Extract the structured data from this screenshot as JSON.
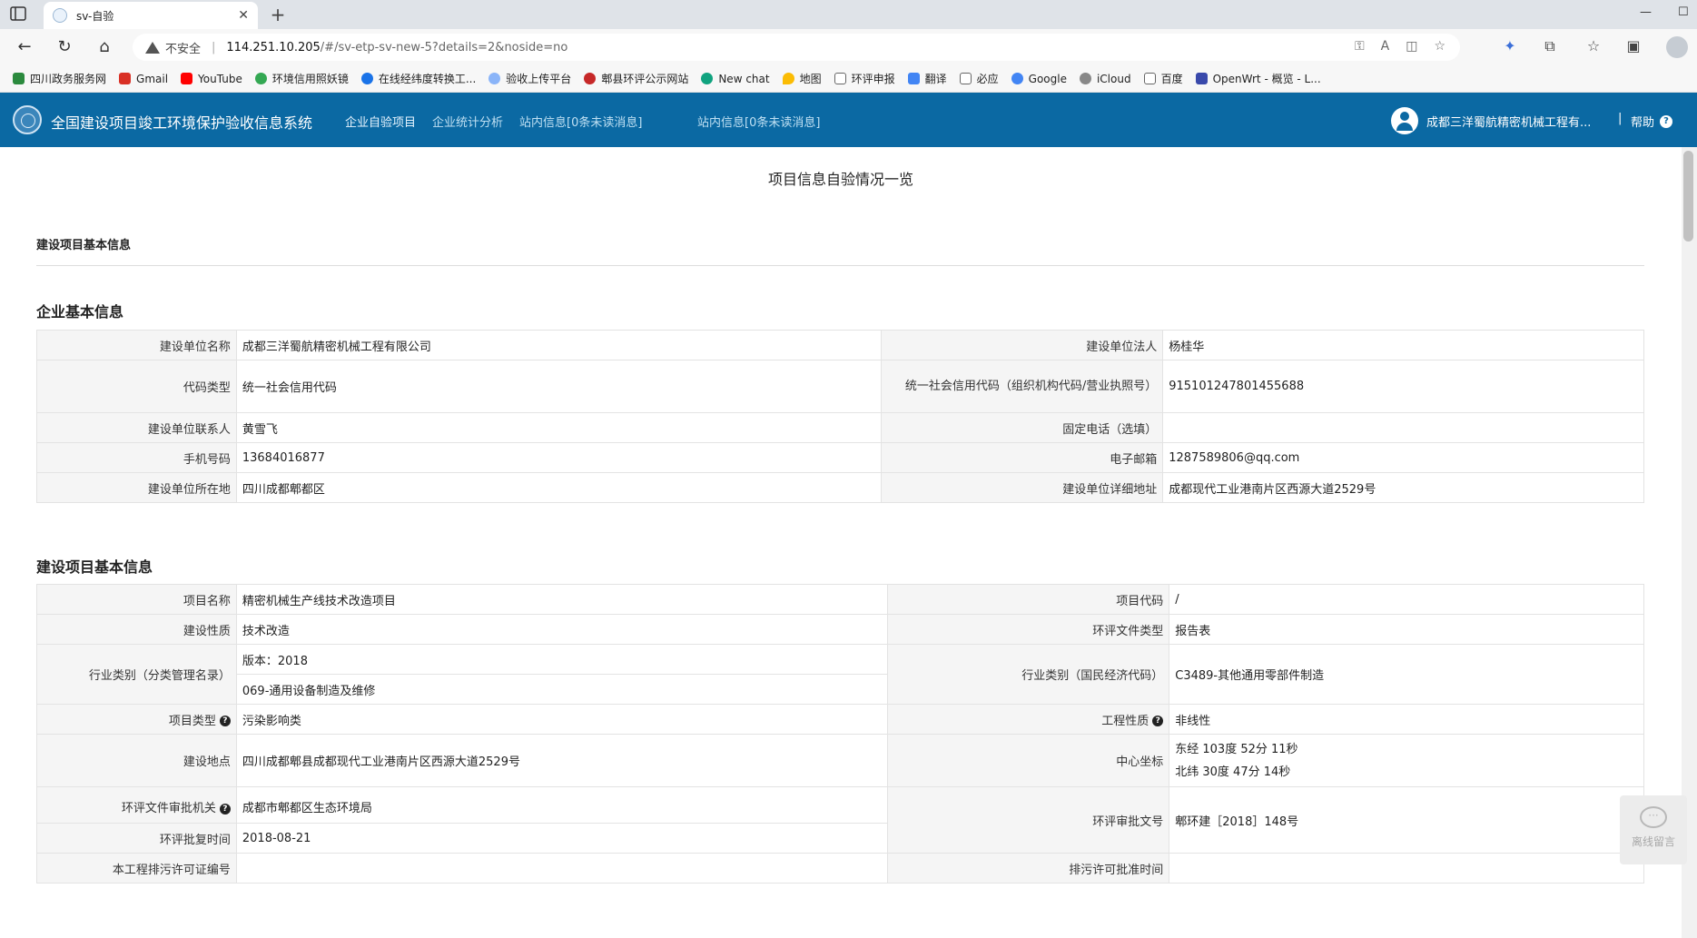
{
  "browser": {
    "tab_title": "sv-自验",
    "new_tab": "+",
    "insecure_label": "不安全",
    "url_host": "114.251.10.205",
    "url_path": "/#/sv-etp-sv-new-5?details=2&noside=no",
    "bookmarks": [
      {
        "label": "四川政务服务网",
        "color": "#2b8a3e"
      },
      {
        "label": "Gmail",
        "color": "#d93025"
      },
      {
        "label": "YouTube",
        "color": "#ff0000"
      },
      {
        "label": "环境信用照妖镜",
        "color": "#34a853"
      },
      {
        "label": "在线经纬度转换工...",
        "color": "#1a73e8"
      },
      {
        "label": "验收上传平台",
        "color": "#8ab4f8"
      },
      {
        "label": "郫县环评公示网站",
        "color": "#c62828"
      },
      {
        "label": "New chat",
        "color": "#10a37f"
      },
      {
        "label": "地图",
        "color": "#fbbc04"
      },
      {
        "label": "环评申报",
        "color": "#666666"
      },
      {
        "label": "翻译",
        "color": "#4285f4"
      },
      {
        "label": "必应",
        "color": "#666666"
      },
      {
        "label": "Google",
        "color": "#4285f4"
      },
      {
        "label": "iCloud",
        "color": "#888888"
      },
      {
        "label": "百度",
        "color": "#666666"
      },
      {
        "label": "OpenWrt - 概览 - L...",
        "color": "#3949ab"
      }
    ]
  },
  "header": {
    "system_title": "全国建设项目竣工环境保护验收信息系统",
    "nav": [
      {
        "label": "企业自验项目"
      },
      {
        "label": "企业统计分析"
      },
      {
        "label": "站内信息[0条未读消息]"
      },
      {
        "label": "站内信息[0条未读消息]"
      }
    ],
    "user_name": "成都三洋蜀航精密机械工程有...",
    "separator": "|",
    "help_label": "帮助",
    "help_icon": "?"
  },
  "page": {
    "title": "项目信息自验情况一览",
    "section_basic": "建设项目基本信息"
  },
  "enterprise": {
    "heading": "企业基本信息",
    "rows": [
      {
        "l1": "建设单位名称",
        "v1": "成都三洋蜀航精密机械工程有限公司",
        "l2": "建设单位法人",
        "v2": "杨桂华"
      },
      {
        "l1": "代码类型",
        "v1": "统一社会信用代码",
        "l2": "统一社会信用代码（组织机构代码/营业执照号）",
        "v2": "915101247801455688"
      },
      {
        "l1": "建设单位联系人",
        "v1": "黄雪飞",
        "l2": "固定电话（选填）",
        "v2": ""
      },
      {
        "l1": "手机号码",
        "v1": "13684016877",
        "l2": "电子邮箱",
        "v2": "1287589806@qq.com"
      },
      {
        "l1": "建设单位所在地",
        "v1": "四川成都郫都区",
        "l2": "建设单位详细地址",
        "v2": "成都现代工业港南片区西源大道2529号"
      }
    ]
  },
  "project": {
    "heading": "建设项目基本信息",
    "name_label": "项目名称",
    "name_value": "精密机械生产线技术改造项目",
    "code_label": "项目代码",
    "code_value": "/",
    "nature_label": "建设性质",
    "nature_value": "技术改造",
    "doc_type_label": "环评文件类型",
    "doc_type_value": "报告表",
    "industry_label": "行业类别（分类管理名录）",
    "industry_version": "版本：2018",
    "industry_value": "069-通用设备制造及维修",
    "industry_nat_label": "行业类别（国民经济代码）",
    "industry_nat_value": "C3489-其他通用零部件制造",
    "ptype_label": "项目类型",
    "ptype_value": "污染影响类",
    "eng_label": "工程性质",
    "eng_value": "非线性",
    "site_label": "建设地点",
    "site_value": "四川成都郫县成都现代工业港南片区西源大道2529号",
    "coord_label": "中心坐标",
    "coord_east": "东经 103度 52分 11秒",
    "coord_north": "北纬 30度 47分 14秒",
    "approver_label": "环评文件审批机关",
    "approver_value": "成都市郫都区生态环境局",
    "approval_no_label": "环评审批文号",
    "approval_no_value": "郫环建［2018］148号",
    "approval_date_label": "环评批复时间",
    "approval_date_value": "2018-08-21",
    "permit_no_label": "本工程排污许可证编号",
    "permit_no_value": "",
    "permit_date_label": "排污许可批准时间",
    "permit_date_value": ""
  },
  "widget": {
    "label": "离线留言"
  }
}
